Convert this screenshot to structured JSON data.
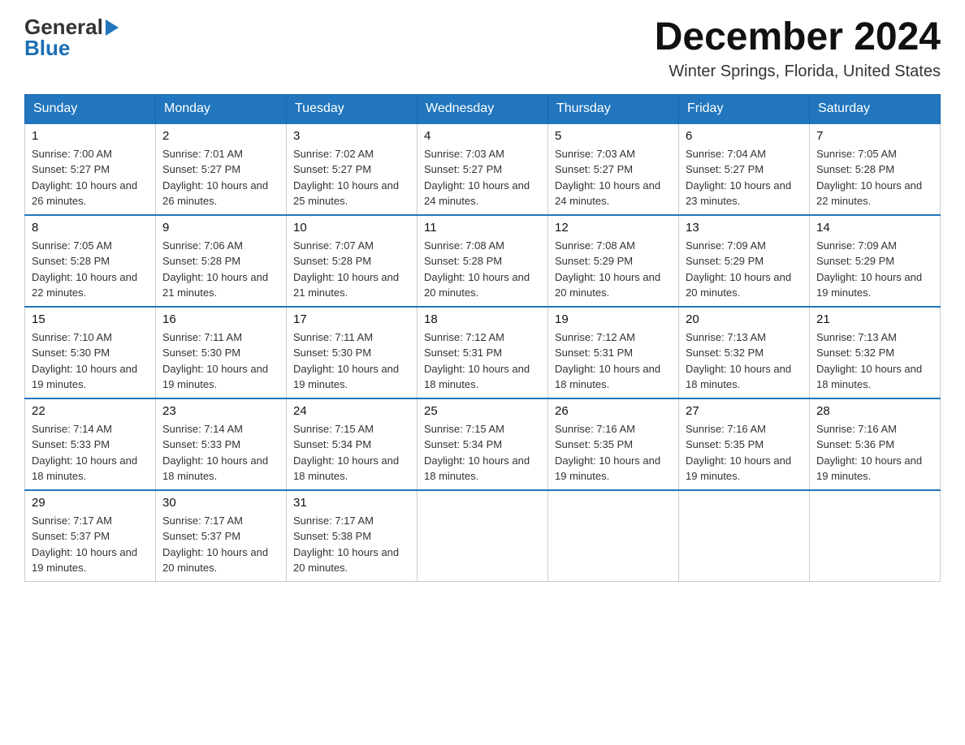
{
  "header": {
    "logo_general": "General",
    "logo_arrow": "▶",
    "logo_blue": "Blue",
    "month_year": "December 2024",
    "location": "Winter Springs, Florida, United States"
  },
  "days_of_week": [
    "Sunday",
    "Monday",
    "Tuesday",
    "Wednesday",
    "Thursday",
    "Friday",
    "Saturday"
  ],
  "weeks": [
    [
      {
        "day": "1",
        "sunrise": "7:00 AM",
        "sunset": "5:27 PM",
        "daylight": "10 hours and 26 minutes."
      },
      {
        "day": "2",
        "sunrise": "7:01 AM",
        "sunset": "5:27 PM",
        "daylight": "10 hours and 26 minutes."
      },
      {
        "day": "3",
        "sunrise": "7:02 AM",
        "sunset": "5:27 PM",
        "daylight": "10 hours and 25 minutes."
      },
      {
        "day": "4",
        "sunrise": "7:03 AM",
        "sunset": "5:27 PM",
        "daylight": "10 hours and 24 minutes."
      },
      {
        "day": "5",
        "sunrise": "7:03 AM",
        "sunset": "5:27 PM",
        "daylight": "10 hours and 24 minutes."
      },
      {
        "day": "6",
        "sunrise": "7:04 AM",
        "sunset": "5:27 PM",
        "daylight": "10 hours and 23 minutes."
      },
      {
        "day": "7",
        "sunrise": "7:05 AM",
        "sunset": "5:28 PM",
        "daylight": "10 hours and 22 minutes."
      }
    ],
    [
      {
        "day": "8",
        "sunrise": "7:05 AM",
        "sunset": "5:28 PM",
        "daylight": "10 hours and 22 minutes."
      },
      {
        "day": "9",
        "sunrise": "7:06 AM",
        "sunset": "5:28 PM",
        "daylight": "10 hours and 21 minutes."
      },
      {
        "day": "10",
        "sunrise": "7:07 AM",
        "sunset": "5:28 PM",
        "daylight": "10 hours and 21 minutes."
      },
      {
        "day": "11",
        "sunrise": "7:08 AM",
        "sunset": "5:28 PM",
        "daylight": "10 hours and 20 minutes."
      },
      {
        "day": "12",
        "sunrise": "7:08 AM",
        "sunset": "5:29 PM",
        "daylight": "10 hours and 20 minutes."
      },
      {
        "day": "13",
        "sunrise": "7:09 AM",
        "sunset": "5:29 PM",
        "daylight": "10 hours and 20 minutes."
      },
      {
        "day": "14",
        "sunrise": "7:09 AM",
        "sunset": "5:29 PM",
        "daylight": "10 hours and 19 minutes."
      }
    ],
    [
      {
        "day": "15",
        "sunrise": "7:10 AM",
        "sunset": "5:30 PM",
        "daylight": "10 hours and 19 minutes."
      },
      {
        "day": "16",
        "sunrise": "7:11 AM",
        "sunset": "5:30 PM",
        "daylight": "10 hours and 19 minutes."
      },
      {
        "day": "17",
        "sunrise": "7:11 AM",
        "sunset": "5:30 PM",
        "daylight": "10 hours and 19 minutes."
      },
      {
        "day": "18",
        "sunrise": "7:12 AM",
        "sunset": "5:31 PM",
        "daylight": "10 hours and 18 minutes."
      },
      {
        "day": "19",
        "sunrise": "7:12 AM",
        "sunset": "5:31 PM",
        "daylight": "10 hours and 18 minutes."
      },
      {
        "day": "20",
        "sunrise": "7:13 AM",
        "sunset": "5:32 PM",
        "daylight": "10 hours and 18 minutes."
      },
      {
        "day": "21",
        "sunrise": "7:13 AM",
        "sunset": "5:32 PM",
        "daylight": "10 hours and 18 minutes."
      }
    ],
    [
      {
        "day": "22",
        "sunrise": "7:14 AM",
        "sunset": "5:33 PM",
        "daylight": "10 hours and 18 minutes."
      },
      {
        "day": "23",
        "sunrise": "7:14 AM",
        "sunset": "5:33 PM",
        "daylight": "10 hours and 18 minutes."
      },
      {
        "day": "24",
        "sunrise": "7:15 AM",
        "sunset": "5:34 PM",
        "daylight": "10 hours and 18 minutes."
      },
      {
        "day": "25",
        "sunrise": "7:15 AM",
        "sunset": "5:34 PM",
        "daylight": "10 hours and 18 minutes."
      },
      {
        "day": "26",
        "sunrise": "7:16 AM",
        "sunset": "5:35 PM",
        "daylight": "10 hours and 19 minutes."
      },
      {
        "day": "27",
        "sunrise": "7:16 AM",
        "sunset": "5:35 PM",
        "daylight": "10 hours and 19 minutes."
      },
      {
        "day": "28",
        "sunrise": "7:16 AM",
        "sunset": "5:36 PM",
        "daylight": "10 hours and 19 minutes."
      }
    ],
    [
      {
        "day": "29",
        "sunrise": "7:17 AM",
        "sunset": "5:37 PM",
        "daylight": "10 hours and 19 minutes."
      },
      {
        "day": "30",
        "sunrise": "7:17 AM",
        "sunset": "5:37 PM",
        "daylight": "10 hours and 20 minutes."
      },
      {
        "day": "31",
        "sunrise": "7:17 AM",
        "sunset": "5:38 PM",
        "daylight": "10 hours and 20 minutes."
      },
      null,
      null,
      null,
      null
    ]
  ],
  "labels": {
    "sunrise_prefix": "Sunrise: ",
    "sunset_prefix": "Sunset: ",
    "daylight_prefix": "Daylight: "
  }
}
